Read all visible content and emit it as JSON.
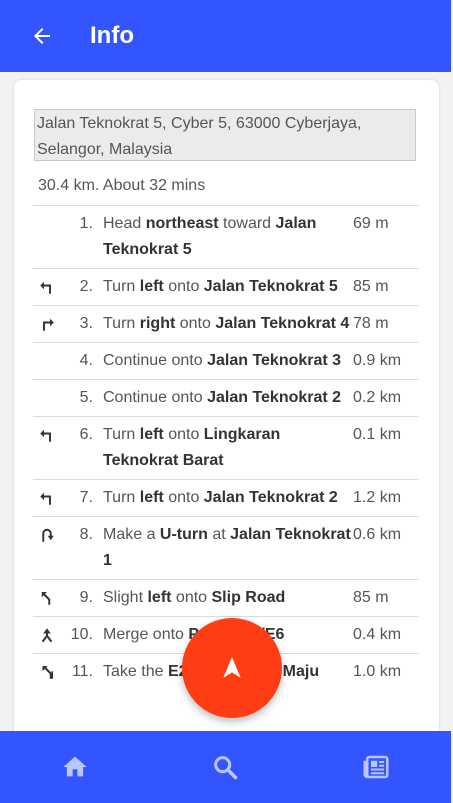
{
  "appbar": {
    "title": "Info"
  },
  "route": {
    "address": "Jalan Teknokrat 5, Cyber 5, 63000 Cyberjaya, Selangor, Malaysia",
    "summary": "30.4 km. About 32 mins"
  },
  "steps": [
    {
      "icon": "none",
      "num": "1.",
      "parts": [
        [
          "Head ",
          0
        ],
        [
          "northeast",
          1
        ],
        [
          " toward ",
          0
        ],
        [
          "Jalan Teknokrat 5",
          1
        ]
      ],
      "dist": "69 m"
    },
    {
      "icon": "turn-left-icon",
      "num": "2.",
      "parts": [
        [
          "Turn ",
          0
        ],
        [
          "left",
          1
        ],
        [
          " onto ",
          0
        ],
        [
          "Jalan Teknokrat 5",
          1
        ]
      ],
      "dist": "85 m"
    },
    {
      "icon": "turn-right-icon",
      "num": "3.",
      "parts": [
        [
          "Turn ",
          0
        ],
        [
          "right",
          1
        ],
        [
          " onto ",
          0
        ],
        [
          "Jalan Teknokrat 4",
          1
        ]
      ],
      "dist": "78 m"
    },
    {
      "icon": "none",
      "num": "4.",
      "parts": [
        [
          "Continue onto ",
          0
        ],
        [
          "Jalan Teknokrat 3",
          1
        ]
      ],
      "dist": "0.9 km"
    },
    {
      "icon": "none",
      "num": "5.",
      "parts": [
        [
          "Continue onto ",
          0
        ],
        [
          "Jalan Teknokrat 2",
          1
        ]
      ],
      "dist": "0.2 km"
    },
    {
      "icon": "turn-left-icon",
      "num": "6.",
      "parts": [
        [
          "Turn ",
          0
        ],
        [
          "left",
          1
        ],
        [
          " onto ",
          0
        ],
        [
          "Lingkaran Teknokrat Barat",
          1
        ]
      ],
      "dist": "0.1 km"
    },
    {
      "icon": "turn-left-icon",
      "num": "7.",
      "parts": [
        [
          "Turn ",
          0
        ],
        [
          "left",
          1
        ],
        [
          " onto ",
          0
        ],
        [
          "Jalan Teknokrat 2",
          1
        ]
      ],
      "dist": "1.2 km"
    },
    {
      "icon": "u-turn-icon",
      "num": "8.",
      "parts": [
        [
          "Make a ",
          0
        ],
        [
          "U-turn",
          1
        ],
        [
          " at ",
          0
        ],
        [
          "Jalan Teknokrat 1",
          1
        ]
      ],
      "dist": "0.6 km"
    },
    {
      "icon": "slight-left-icon",
      "num": "9.",
      "parts": [
        [
          "Slight ",
          0
        ],
        [
          "left",
          1
        ],
        [
          " onto ",
          0
        ],
        [
          "Slip Road",
          1
        ]
      ],
      "dist": "85 m"
    },
    {
      "icon": "merge-icon",
      "num": "10.",
      "parts": [
        [
          "Merge onto ",
          0
        ],
        [
          "Putrajaya/E6",
          1
        ]
      ],
      "dist": "0.4 km"
    },
    {
      "icon": "exit-left-icon",
      "num": "11.",
      "parts": [
        [
          "Take the ",
          0
        ],
        [
          "E20",
          1
        ],
        [
          " exit toward ",
          0
        ],
        [
          "Maju",
          1
        ]
      ],
      "dist": "1.0 km"
    }
  ],
  "colors": {
    "primary": "#3355ff",
    "fab": "#ff3d14"
  },
  "fab": {
    "icon": "navigation-icon"
  },
  "bottom_nav": [
    {
      "icon": "home-icon"
    },
    {
      "icon": "search-icon"
    },
    {
      "icon": "news-icon"
    }
  ]
}
